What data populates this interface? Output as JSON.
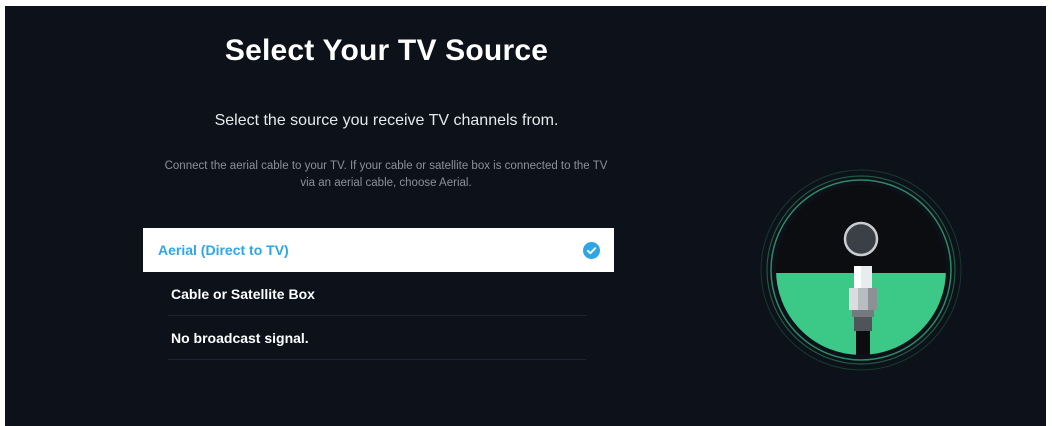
{
  "page": {
    "title": "Select Your TV Source",
    "subtitle": "Select the source you receive TV channels from.",
    "description_line1": "Connect the aerial cable to your TV. If your cable or satellite box is connected to the TV",
    "description_line2": "via an aerial cable, choose Aerial."
  },
  "options": [
    {
      "label": "Aerial (Direct to TV)",
      "selected": true
    },
    {
      "label": "Cable or Satellite Box",
      "selected": false
    },
    {
      "label": "No broadcast signal.",
      "selected": false
    }
  ],
  "icons": {
    "selected_option": "checkmark-circle-icon",
    "illustration": "aerial-cable-illustration"
  },
  "colors": {
    "background": "#0c111a",
    "accent": "#2ea6e6",
    "illustration_green": "#3cc886"
  }
}
